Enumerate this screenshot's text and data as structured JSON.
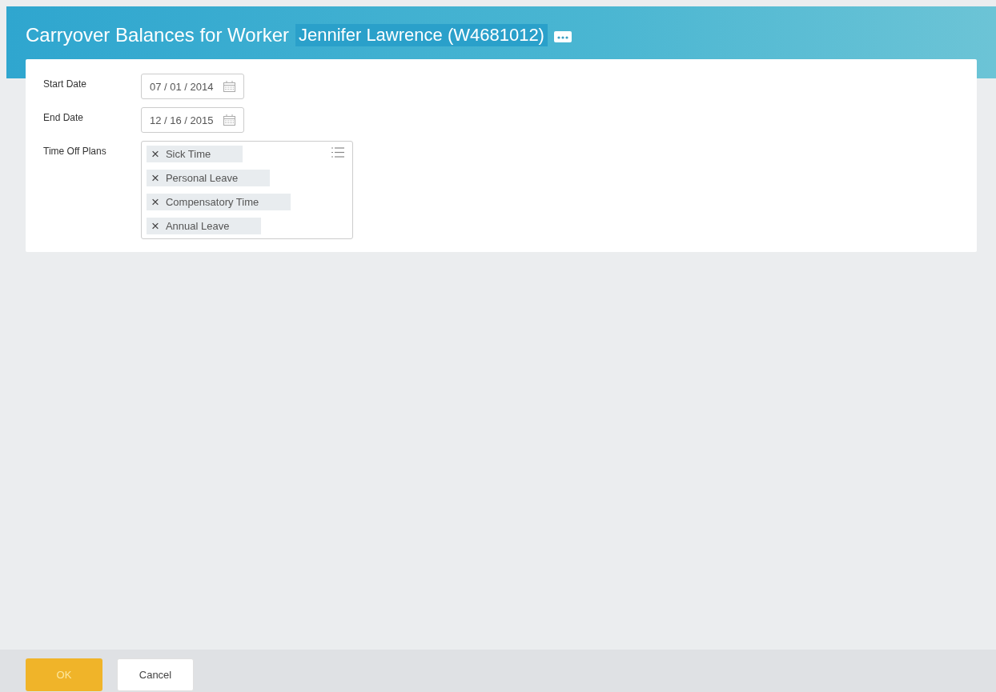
{
  "header": {
    "title": "Carryover Balances for Worker",
    "worker": "Jennifer Lawrence (W4681012)"
  },
  "fields": [
    {
      "label": "Start Date",
      "kind": "date",
      "value": "07 / 01 / 2014"
    },
    {
      "label": "End Date",
      "kind": "date",
      "value": "12 / 16 / 2015"
    },
    {
      "label": "Time Off Plans",
      "kind": "multi",
      "remove": "×",
      "items": [
        "Sick Time",
        "Personal Leave",
        "Compensatory Time",
        "Annual Leave"
      ]
    }
  ],
  "buttons": [
    {
      "label": "OK",
      "kind": "primary"
    },
    {
      "label": "Cancel",
      "kind": "secondary"
    }
  ]
}
